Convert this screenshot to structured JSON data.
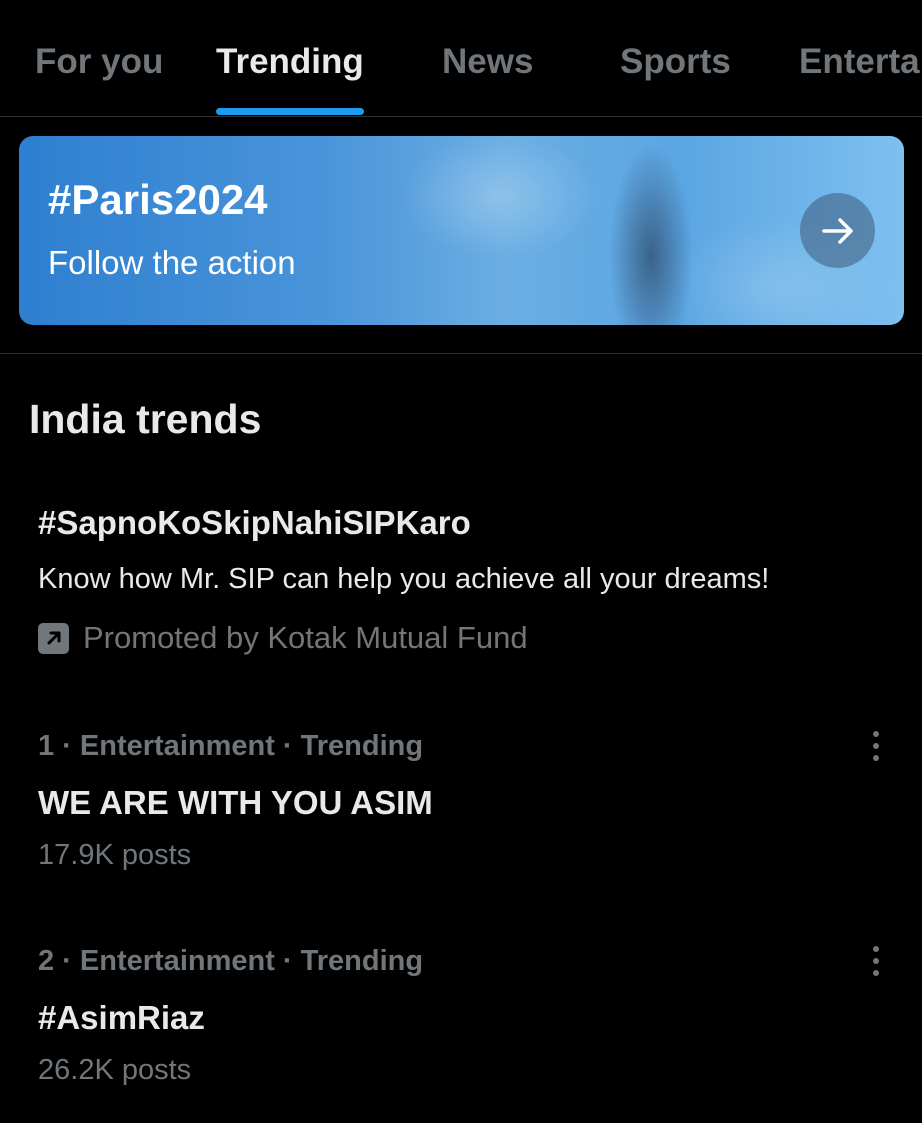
{
  "tabs": [
    {
      "label": "For you",
      "active": false
    },
    {
      "label": "Trending",
      "active": true
    },
    {
      "label": "News",
      "active": false
    },
    {
      "label": "Sports",
      "active": false
    },
    {
      "label": "Enterta",
      "active": false
    }
  ],
  "banner": {
    "title": "#Paris2024",
    "subtitle": "Follow the action",
    "action_icon": "arrow-right-icon"
  },
  "section": {
    "title": "India trends"
  },
  "promoted": {
    "tag": "#SapnoKoSkipNahiSIPKaro",
    "description": "Know how Mr. SIP can help you achieve all your dreams!",
    "promoted_by": "Promoted by Kotak Mutual Fund",
    "icon": "promoted-arrow-icon"
  },
  "trends": [
    {
      "meta": "1 · Entertainment · Trending",
      "name": "WE ARE WITH YOU ASIM",
      "count": "17.9K posts"
    },
    {
      "meta": "2 · Entertainment · Trending",
      "name": "#AsimRiaz",
      "count": "26.2K posts"
    }
  ],
  "colors": {
    "background": "#000000",
    "accent": "#1d9bf0",
    "text_primary": "#e7e9ea",
    "text_secondary": "#71767b",
    "divider": "#2f3336"
  }
}
